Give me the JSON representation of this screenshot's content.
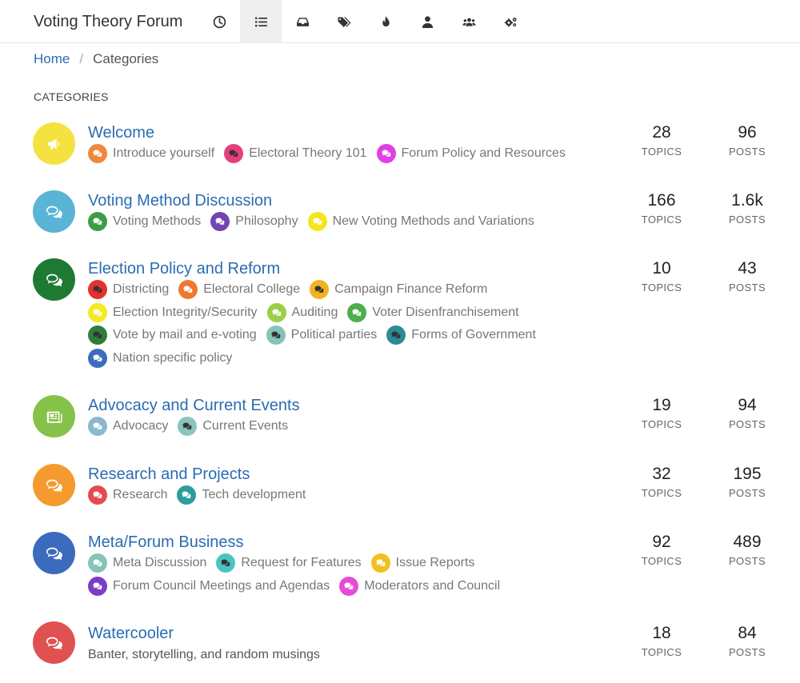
{
  "header": {
    "title": "Voting Theory Forum",
    "nav": [
      {
        "icon": "clock-icon",
        "name": "nav-recent"
      },
      {
        "icon": "list-icon",
        "name": "nav-categories",
        "active": true
      },
      {
        "icon": "inbox-icon",
        "name": "nav-unread"
      },
      {
        "icon": "tags-icon",
        "name": "nav-tags"
      },
      {
        "icon": "fire-icon",
        "name": "nav-popular"
      },
      {
        "icon": "user-icon",
        "name": "nav-users"
      },
      {
        "icon": "users-icon",
        "name": "nav-groups"
      },
      {
        "icon": "gears-icon",
        "name": "nav-admin"
      }
    ]
  },
  "breadcrumb": {
    "home": "Home",
    "current": "Categories"
  },
  "section_title": "CATEGORIES",
  "stat_labels": {
    "topics": "TOPICS",
    "posts": "POSTS"
  },
  "categories": [
    {
      "title": "Welcome",
      "color": "#f5e140",
      "icon": "bullhorn-icon",
      "topics": "28",
      "posts": "96",
      "subs": [
        {
          "label": "Introduce yourself",
          "color": "#f0883a",
          "glyph": "#ffffff"
        },
        {
          "label": "Electoral Theory 101",
          "color": "#e63e7d",
          "glyph": "#333333"
        },
        {
          "label": "Forum Policy and Resources",
          "color": "#e040e8",
          "glyph": "#ffffff"
        }
      ]
    },
    {
      "title": "Voting Method Discussion",
      "color": "#5ab4d6",
      "icon": "comments-icon",
      "topics": "166",
      "posts": "1.6k",
      "subs": [
        {
          "label": "Voting Methods",
          "color": "#3e9c45",
          "glyph": "#ffffff"
        },
        {
          "label": "Philosophy",
          "color": "#6f46b3",
          "glyph": "#ffffff"
        },
        {
          "label": "New Voting Methods and Variations",
          "color": "#f5e61a",
          "glyph": "#ffffff"
        }
      ]
    },
    {
      "title": "Election Policy and Reform",
      "color": "#1e7a33",
      "icon": "comments-icon",
      "topics": "10",
      "posts": "43",
      "subs": [
        {
          "label": "Districting",
          "color": "#e53030",
          "glyph": "#333333"
        },
        {
          "label": "Electoral College",
          "color": "#f0782e",
          "glyph": "#ffffff"
        },
        {
          "label": "Campaign Finance Reform",
          "color": "#f2b220",
          "glyph": "#333333"
        },
        {
          "label": "Election Integrity/Security",
          "color": "#f5ea20",
          "glyph": "#ffffff"
        },
        {
          "label": "Auditing",
          "color": "#9ccf44",
          "glyph": "#ffffff"
        },
        {
          "label": "Voter Disenfranchisement",
          "color": "#4cae4c",
          "glyph": "#ffffff"
        },
        {
          "label": "Vote by mail and e-voting",
          "color": "#2e7d3a",
          "glyph": "#333333"
        },
        {
          "label": "Political parties",
          "color": "#86c3b8",
          "glyph": "#333333"
        },
        {
          "label": "Forms of Government",
          "color": "#2c8b96",
          "glyph": "#333333"
        },
        {
          "label": "Nation specific policy",
          "color": "#3c6cc0",
          "glyph": "#ffffff"
        }
      ]
    },
    {
      "title": "Advocacy and Current Events",
      "color": "#86c24a",
      "icon": "newspaper-icon",
      "topics": "19",
      "posts": "94",
      "subs": [
        {
          "label": "Advocacy",
          "color": "#8ab8d0",
          "glyph": "#ffffff"
        },
        {
          "label": "Current Events",
          "color": "#8ac4bd",
          "glyph": "#333333"
        }
      ]
    },
    {
      "title": "Research and Projects",
      "color": "#f59a2e",
      "icon": "comments-icon",
      "topics": "32",
      "posts": "195",
      "subs": [
        {
          "label": "Research",
          "color": "#e64b4b",
          "glyph": "#ffffff"
        },
        {
          "label": "Tech development",
          "color": "#2e9c9c",
          "glyph": "#ffffff"
        }
      ]
    },
    {
      "title": "Meta/Forum Business",
      "color": "#3b6bbd",
      "icon": "comments-icon",
      "topics": "92",
      "posts": "489",
      "subs": [
        {
          "label": "Meta Discussion",
          "color": "#86c3b8",
          "glyph": "#ffffff"
        },
        {
          "label": "Request for Features",
          "color": "#4cc5c2",
          "glyph": "#333333"
        },
        {
          "label": "Issue Reports",
          "color": "#f0c020",
          "glyph": "#ffffff"
        },
        {
          "label": "Forum Council Meetings and Agendas",
          "color": "#7d3cc8",
          "glyph": "#ffffff"
        },
        {
          "label": "Moderators and Council",
          "color": "#e64bd6",
          "glyph": "#ffffff"
        }
      ]
    },
    {
      "title": "Watercooler",
      "color": "#e05252",
      "icon": "comments-icon",
      "topics": "18",
      "posts": "84",
      "description": "Banter, storytelling, and random musings",
      "subs": []
    }
  ]
}
